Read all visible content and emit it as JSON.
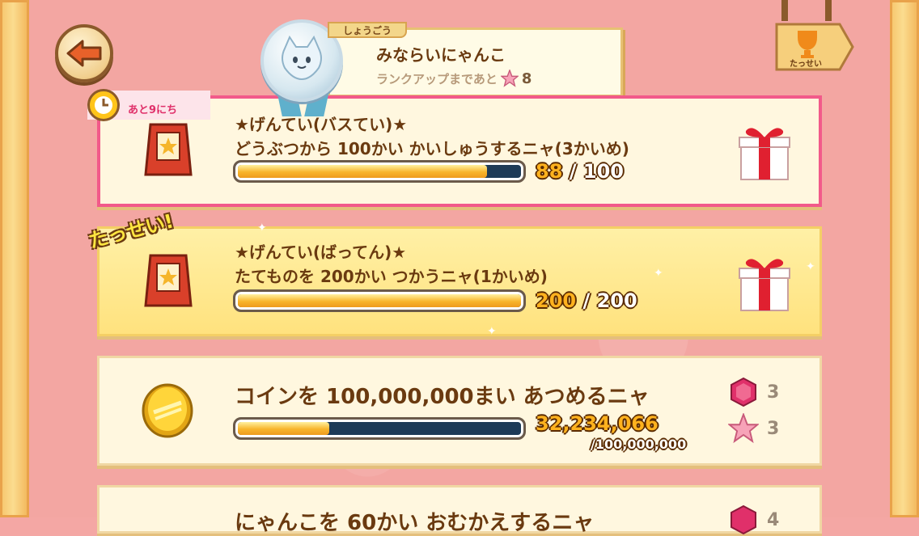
{
  "header": {
    "title_tag": "しょうごう",
    "title_name": "みならいにゃんこ",
    "rankup_text": "ランクアップまであと",
    "rankup_remaining": "8",
    "achievement_label": "たっせい"
  },
  "missions": [
    {
      "timer_label": "あと9にち",
      "title_line1": "★げんてい(バスてい)★",
      "title_line2": "どうぶつから 100かい かいしゅうするニャ(3かいめ)",
      "progress_current": "88",
      "progress_sep": "/",
      "progress_total": "100",
      "progress_fraction": 0.88,
      "reward": "gift"
    },
    {
      "status_badge": "たっせい!",
      "title_line1": "★げんてい(ばってん)★",
      "title_line2": "たてものを 200かい つかうニャ(1かいめ)",
      "progress_current": "200",
      "progress_sep": "/",
      "progress_total": "200",
      "progress_fraction": 1.0,
      "reward": "gift"
    },
    {
      "title_line1": "コインを 100,000,000まい あつめるニャ",
      "progress_current": "32,234,066",
      "progress_total": "/100,000,000",
      "progress_fraction": 0.322,
      "rewards": [
        {
          "icon": "gem-icon",
          "count": "3"
        },
        {
          "icon": "star-icon",
          "count": "3"
        }
      ]
    },
    {
      "title_line1": "にゃんこを 60かい おむかえするニャ",
      "reward_count": "4"
    }
  ],
  "colors": {
    "background": "#f3a6a2",
    "frame": "#f6c46a",
    "highlight_border": "#f25a8a",
    "completed_bg": "#ffe27e",
    "text_brown": "#6a3a10",
    "count_orange": "#ffb21e",
    "bar_dark": "#1d3a57"
  }
}
